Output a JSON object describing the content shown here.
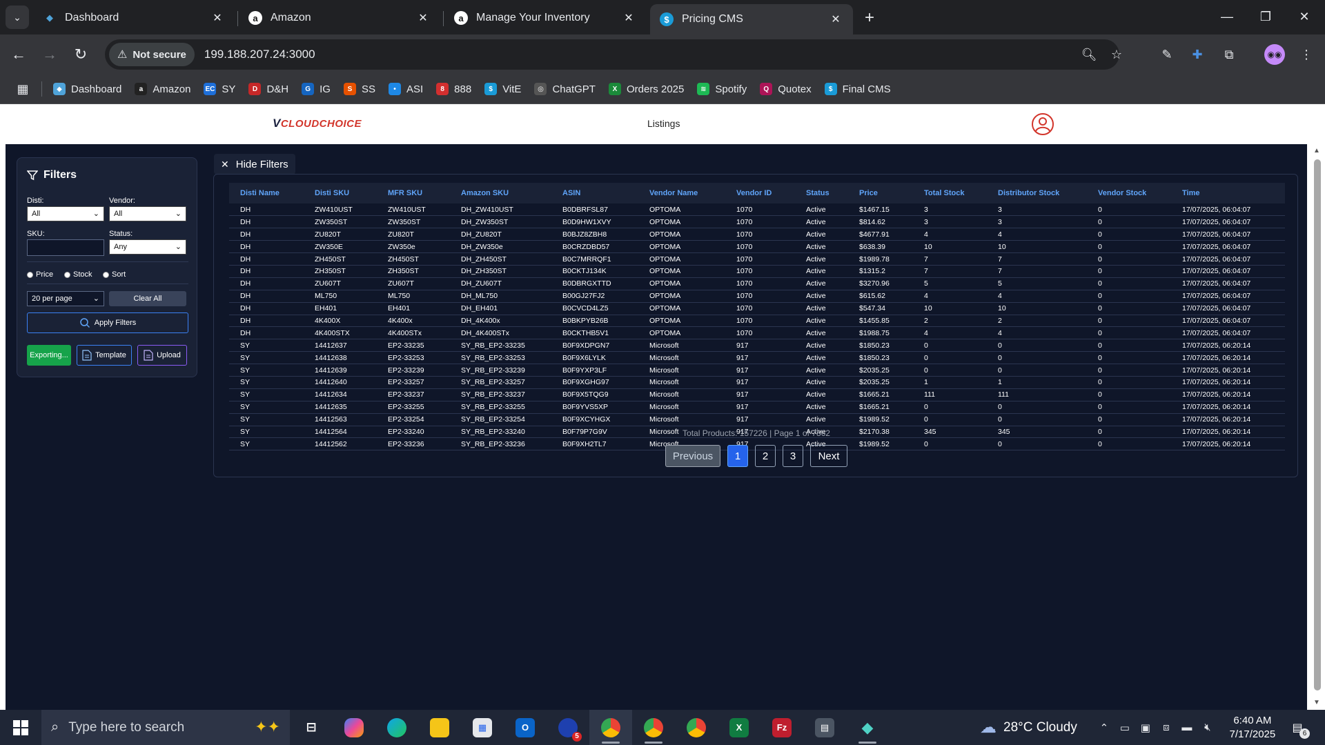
{
  "browser": {
    "tabs": [
      {
        "title": "Dashboard",
        "icon": "dashboard-diamond-icon",
        "color": "#4fa3d9",
        "glyph": "◆"
      },
      {
        "title": "Amazon",
        "icon": "amazon-icon",
        "color": "#ffffff",
        "glyph": "a"
      },
      {
        "title": "Manage Your Inventory",
        "icon": "amazon-icon",
        "color": "#ffffff",
        "glyph": "a"
      },
      {
        "title": "Pricing CMS",
        "icon": "dollar-icon",
        "color": "#1a9bd7",
        "glyph": "$"
      }
    ],
    "security_label": "Not secure",
    "url": "199.188.207.24:3000",
    "bookmarks": [
      {
        "label": "Dashboard",
        "color": "#4fa3d9",
        "glyph": "◆"
      },
      {
        "label": "Amazon",
        "color": "#222222",
        "glyph": "a"
      },
      {
        "label": "SY",
        "color": "#1e6fd9",
        "glyph": "EC"
      },
      {
        "label": "D&H",
        "color": "#c62828",
        "glyph": "D"
      },
      {
        "label": "IG",
        "color": "#1565c0",
        "glyph": "G"
      },
      {
        "label": "SS",
        "color": "#e65100",
        "glyph": "S"
      },
      {
        "label": "ASI",
        "color": "#1e88e5",
        "glyph": "•"
      },
      {
        "label": "888",
        "color": "#d32f2f",
        "glyph": "8"
      },
      {
        "label": "VitE",
        "color": "#1a9bd7",
        "glyph": "$"
      },
      {
        "label": "ChatGPT",
        "color": "#555555",
        "glyph": "◎"
      },
      {
        "label": "Orders 2025",
        "color": "#1b8a3a",
        "glyph": "X"
      },
      {
        "label": "Spotify",
        "color": "#1db954",
        "glyph": "≋"
      },
      {
        "label": "Quotex",
        "color": "#ad1457",
        "glyph": "Q"
      },
      {
        "label": "Final CMS",
        "color": "#1a9bd7",
        "glyph": "$"
      }
    ]
  },
  "app": {
    "logo_v": "V",
    "logo_rest": "CLOUDCHOICE",
    "nav_listings": "Listings"
  },
  "filters": {
    "title": "Filters",
    "disti_label": "Disti:",
    "disti_value": "All",
    "vendor_label": "Vendor:",
    "vendor_value": "All",
    "sku_label": "SKU:",
    "status_label": "Status:",
    "status_value": "Any",
    "radio_price": "Price",
    "radio_stock": "Stock",
    "radio_sort": "Sort",
    "per_page": "20 per page",
    "clear_all": "Clear All",
    "apply": "Apply Filters",
    "export": "Exporting...",
    "template": "Template",
    "upload": "Upload"
  },
  "hide_filters": "Hide Filters",
  "table": {
    "columns": [
      "Disti Name",
      "Disti SKU",
      "MFR SKU",
      "Amazon SKU",
      "ASIN",
      "Vendor Name",
      "Vendor ID",
      "Status",
      "Price",
      "Total Stock",
      "Distributor Stock",
      "Vendor Stock",
      "Time"
    ],
    "rows": [
      [
        "DH",
        "ZW410UST",
        "ZW410UST",
        "DH_ZW410UST",
        "B0DBRFSL87",
        "OPTOMA",
        "1070",
        "Active",
        "$1467.15",
        "3",
        "3",
        "0",
        "17/07/2025, 06:04:07"
      ],
      [
        "DH",
        "ZW350ST",
        "ZW350ST",
        "DH_ZW350ST",
        "B0D9HW1XVY",
        "OPTOMA",
        "1070",
        "Active",
        "$814.62",
        "3",
        "3",
        "0",
        "17/07/2025, 06:04:07"
      ],
      [
        "DH",
        "ZU820T",
        "ZU820T",
        "DH_ZU820T",
        "B0BJZ8ZBH8",
        "OPTOMA",
        "1070",
        "Active",
        "$4677.91",
        "4",
        "4",
        "0",
        "17/07/2025, 06:04:07"
      ],
      [
        "DH",
        "ZW350E",
        "ZW350e",
        "DH_ZW350e",
        "B0CRZDBD57",
        "OPTOMA",
        "1070",
        "Active",
        "$638.39",
        "10",
        "10",
        "0",
        "17/07/2025, 06:04:07"
      ],
      [
        "DH",
        "ZH450ST",
        "ZH450ST",
        "DH_ZH450ST",
        "B0C7MRRQF1",
        "OPTOMA",
        "1070",
        "Active",
        "$1989.78",
        "7",
        "7",
        "0",
        "17/07/2025, 06:04:07"
      ],
      [
        "DH",
        "ZH350ST",
        "ZH350ST",
        "DH_ZH350ST",
        "B0CKTJ134K",
        "OPTOMA",
        "1070",
        "Active",
        "$1315.2",
        "7",
        "7",
        "0",
        "17/07/2025, 06:04:07"
      ],
      [
        "DH",
        "ZU607T",
        "ZU607T",
        "DH_ZU607T",
        "B0DBRGXTTD",
        "OPTOMA",
        "1070",
        "Active",
        "$3270.96",
        "5",
        "5",
        "0",
        "17/07/2025, 06:04:07"
      ],
      [
        "DH",
        "ML750",
        "ML750",
        "DH_ML750",
        "B00GJ27FJ2",
        "OPTOMA",
        "1070",
        "Active",
        "$615.62",
        "4",
        "4",
        "0",
        "17/07/2025, 06:04:07"
      ],
      [
        "DH",
        "EH401",
        "EH401",
        "DH_EH401",
        "B0CVCD4LZ5",
        "OPTOMA",
        "1070",
        "Active",
        "$547.34",
        "10",
        "10",
        "0",
        "17/07/2025, 06:04:07"
      ],
      [
        "DH",
        "4K400X",
        "4K400x",
        "DH_4K400x",
        "B0BKPYB26B",
        "OPTOMA",
        "1070",
        "Active",
        "$1455.85",
        "2",
        "2",
        "0",
        "17/07/2025, 06:04:07"
      ],
      [
        "DH",
        "4K400STX",
        "4K400STx",
        "DH_4K400STx",
        "B0CKTHB5V1",
        "OPTOMA",
        "1070",
        "Active",
        "$1988.75",
        "4",
        "4",
        "0",
        "17/07/2025, 06:04:07"
      ],
      [
        "SY",
        "14412637",
        "EP2-33235",
        "SY_RB_EP2-33235",
        "B0F9XDPGN7",
        "Microsoft",
        "917",
        "Active",
        "$1850.23",
        "0",
        "0",
        "0",
        "17/07/2025, 06:20:14"
      ],
      [
        "SY",
        "14412638",
        "EP2-33253",
        "SY_RB_EP2-33253",
        "B0F9X6LYLK",
        "Microsoft",
        "917",
        "Active",
        "$1850.23",
        "0",
        "0",
        "0",
        "17/07/2025, 06:20:14"
      ],
      [
        "SY",
        "14412639",
        "EP2-33239",
        "SY_RB_EP2-33239",
        "B0F9YXP3LF",
        "Microsoft",
        "917",
        "Active",
        "$2035.25",
        "0",
        "0",
        "0",
        "17/07/2025, 06:20:14"
      ],
      [
        "SY",
        "14412640",
        "EP2-33257",
        "SY_RB_EP2-33257",
        "B0F9XGHG97",
        "Microsoft",
        "917",
        "Active",
        "$2035.25",
        "1",
        "1",
        "0",
        "17/07/2025, 06:20:14"
      ],
      [
        "SY",
        "14412634",
        "EP2-33237",
        "SY_RB_EP2-33237",
        "B0F9X5TQG9",
        "Microsoft",
        "917",
        "Active",
        "$1665.21",
        "111",
        "111",
        "0",
        "17/07/2025, 06:20:14"
      ],
      [
        "SY",
        "14412635",
        "EP2-33255",
        "SY_RB_EP2-33255",
        "B0F9YVS5XP",
        "Microsoft",
        "917",
        "Active",
        "$1665.21",
        "0",
        "0",
        "0",
        "17/07/2025, 06:20:14"
      ],
      [
        "SY",
        "14412563",
        "EP2-33254",
        "SY_RB_EP2-33254",
        "B0F9XCYHGX",
        "Microsoft",
        "917",
        "Active",
        "$1989.52",
        "0",
        "0",
        "0",
        "17/07/2025, 06:20:14"
      ],
      [
        "SY",
        "14412564",
        "EP2-33240",
        "SY_RB_EP2-33240",
        "B0F79P7G9V",
        "Microsoft",
        "917",
        "Active",
        "$2170.38",
        "345",
        "345",
        "0",
        "17/07/2025, 06:20:14"
      ],
      [
        "SY",
        "14412562",
        "EP2-33236",
        "SY_RB_EP2-33236",
        "B0F9XH2TL7",
        "Microsoft",
        "917",
        "Active",
        "$1989.52",
        "0",
        "0",
        "0",
        "17/07/2025, 06:20:14"
      ]
    ]
  },
  "pagination": {
    "info": "Total Products: 157226 | Page 1 of 7862",
    "previous": "Previous",
    "pages": [
      "1",
      "2",
      "3"
    ],
    "next": "Next"
  },
  "taskbar": {
    "search_placeholder": "Type here to search",
    "weather": "28°C  Cloudy",
    "time": "6:40 AM",
    "date": "7/17/2025",
    "notification_count": "6",
    "outlook_badge": "5"
  }
}
